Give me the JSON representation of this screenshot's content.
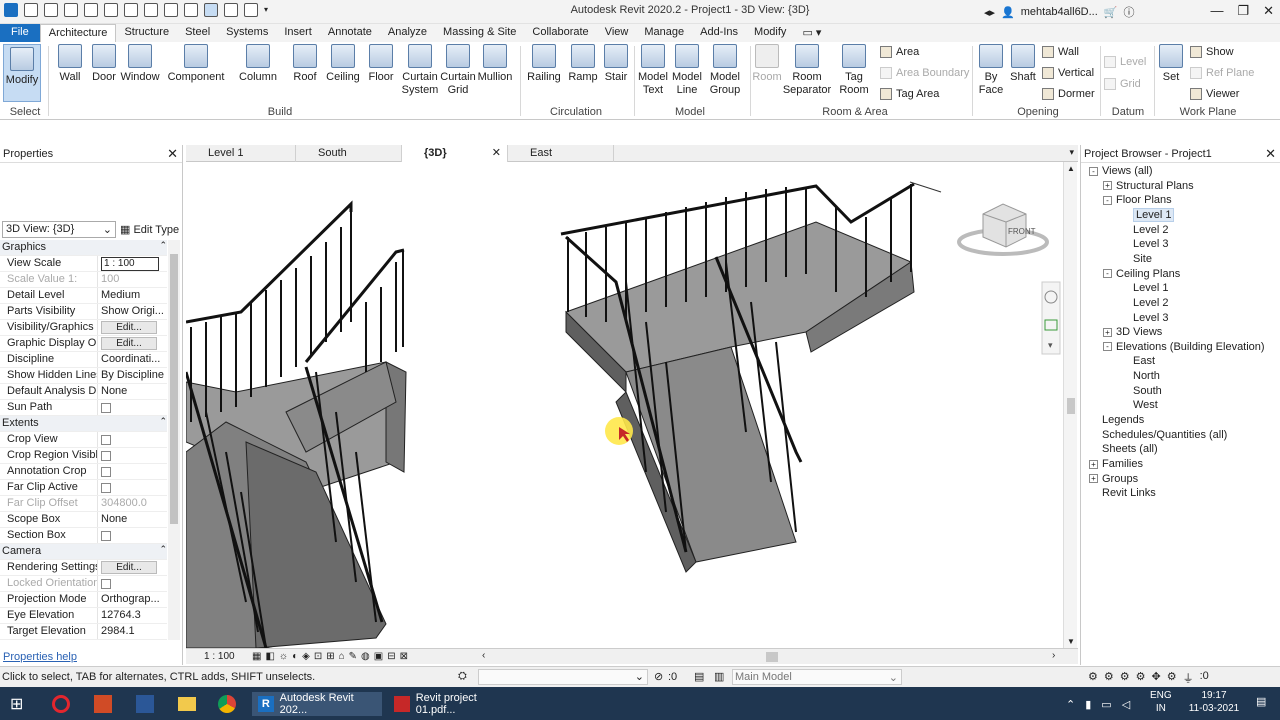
{
  "window": {
    "title": "Autodesk Revit 2020.2 - Project1 - 3D View: {3D}",
    "user": "mehtab4all6D..."
  },
  "ribbon_tabs": [
    "File",
    "Architecture",
    "Structure",
    "Steel",
    "Systems",
    "Insert",
    "Annotate",
    "Analyze",
    "Massing & Site",
    "Collaborate",
    "View",
    "Manage",
    "Add-Ins",
    "Modify"
  ],
  "ribbon": {
    "modify": "Modify",
    "select": "Select",
    "build_tools": [
      "Wall",
      "Door",
      "Window",
      "Component",
      "Column",
      "Roof",
      "Ceiling",
      "Floor",
      "Curtain System",
      "Curtain Grid",
      "Mullion"
    ],
    "build": "Build",
    "circulation_tools": [
      "Railing",
      "Ramp",
      "Stair"
    ],
    "circulation": "Circulation",
    "model_tools": [
      "Model Text",
      "Model Line",
      "Model Group"
    ],
    "model": "Model",
    "room_tools": [
      "Room",
      "Room Separator",
      "Tag Room"
    ],
    "area_items": [
      "Area",
      "Area  Boundary",
      "Tag  Area"
    ],
    "room_area": "Room & Area",
    "opening_tools": [
      "By Face",
      "Shaft"
    ],
    "opening_items": [
      "Wall",
      "Vertical",
      "Dormer"
    ],
    "opening": "Opening",
    "datum_items": [
      "Level",
      "Grid"
    ],
    "datum": "Datum",
    "workplane_tools": [
      "Set"
    ],
    "workplane_items": [
      "Show",
      "Ref  Plane",
      "Viewer"
    ],
    "workplane": "Work Plane"
  },
  "properties": {
    "title": "Properties",
    "type": "3D View: {3D}",
    "edit_type": "Edit Type",
    "rows": [
      {
        "group": "Graphics"
      },
      {
        "k": "View Scale",
        "v": "1 : 100",
        "input": true
      },
      {
        "k": "Scale Value    1:",
        "v": "100",
        "dim": true
      },
      {
        "k": "Detail Level",
        "v": "Medium"
      },
      {
        "k": "Parts Visibility",
        "v": "Show Origi..."
      },
      {
        "k": "Visibility/Graphics ...",
        "v": "Edit...",
        "btn": true
      },
      {
        "k": "Graphic Display O...",
        "v": "Edit...",
        "btn": true
      },
      {
        "k": "Discipline",
        "v": "Coordinati..."
      },
      {
        "k": "Show Hidden Lines",
        "v": "By Discipline"
      },
      {
        "k": "Default Analysis Di...",
        "v": "None"
      },
      {
        "k": "Sun Path",
        "cb": true
      },
      {
        "group": "Extents"
      },
      {
        "k": "Crop View",
        "cb": true
      },
      {
        "k": "Crop Region Visible",
        "cb": true
      },
      {
        "k": "Annotation Crop",
        "cb": true
      },
      {
        "k": "Far Clip Active",
        "cb": true
      },
      {
        "k": "Far Clip Offset",
        "v": "304800.0",
        "dim": true
      },
      {
        "k": "Scope Box",
        "v": "None"
      },
      {
        "k": "Section Box",
        "cb": true
      },
      {
        "group": "Camera"
      },
      {
        "k": "Rendering Settings",
        "v": "Edit...",
        "btn": true
      },
      {
        "k": "Locked Orientation",
        "cb": true,
        "dim": true
      },
      {
        "k": "Projection Mode",
        "v": "Orthograp..."
      },
      {
        "k": "Eye Elevation",
        "v": "12764.3"
      },
      {
        "k": "Target Elevation",
        "v": "2984.1"
      }
    ],
    "help": "Properties help"
  },
  "view_tabs": [
    "Level 1",
    "South",
    "{3D}",
    "East"
  ],
  "view_scale": "1 : 100",
  "viewcube": "FRONT",
  "browser": {
    "title": "Project Browser - Project1",
    "items": [
      {
        "t": "Views (all)",
        "lvl": 0,
        "tg": "-"
      },
      {
        "t": "Structural Plans",
        "lvl": 1,
        "tg": "+"
      },
      {
        "t": "Floor Plans",
        "lvl": 1,
        "tg": "-"
      },
      {
        "t": "Level 1",
        "lvl": 2,
        "sel": true
      },
      {
        "t": "Level 2",
        "lvl": 2
      },
      {
        "t": "Level 3",
        "lvl": 2
      },
      {
        "t": "Site",
        "lvl": 2
      },
      {
        "t": "Ceiling Plans",
        "lvl": 1,
        "tg": "-"
      },
      {
        "t": "Level 1",
        "lvl": 2
      },
      {
        "t": "Level 2",
        "lvl": 2
      },
      {
        "t": "Level 3",
        "lvl": 2
      },
      {
        "t": "3D Views",
        "lvl": 1,
        "tg": "+"
      },
      {
        "t": "Elevations (Building Elevation)",
        "lvl": 1,
        "tg": "-"
      },
      {
        "t": "East",
        "lvl": 2
      },
      {
        "t": "North",
        "lvl": 2
      },
      {
        "t": "South",
        "lvl": 2
      },
      {
        "t": "West",
        "lvl": 2
      },
      {
        "t": "Legends",
        "lvl": 0
      },
      {
        "t": "Schedules/Quantities (all)",
        "lvl": 0
      },
      {
        "t": "Sheets (all)",
        "lvl": 0
      },
      {
        "t": "Families",
        "lvl": 0,
        "tg": "+"
      },
      {
        "t": "Groups",
        "lvl": 0,
        "tg": "+"
      },
      {
        "t": "Revit Links",
        "lvl": 0
      }
    ]
  },
  "status": {
    "text": "Click to select, TAB for alternates, CTRL adds, SHIFT unselects.",
    "zero": ":0",
    "model": "Main Model",
    "filter": ":0"
  },
  "taskbar": {
    "app1": "Autodesk Revit 202...",
    "app2": "Revit project 01.pdf...",
    "lang1": "ENG",
    "lang2": "IN",
    "time": "19:17",
    "date": "11-03-2021"
  }
}
